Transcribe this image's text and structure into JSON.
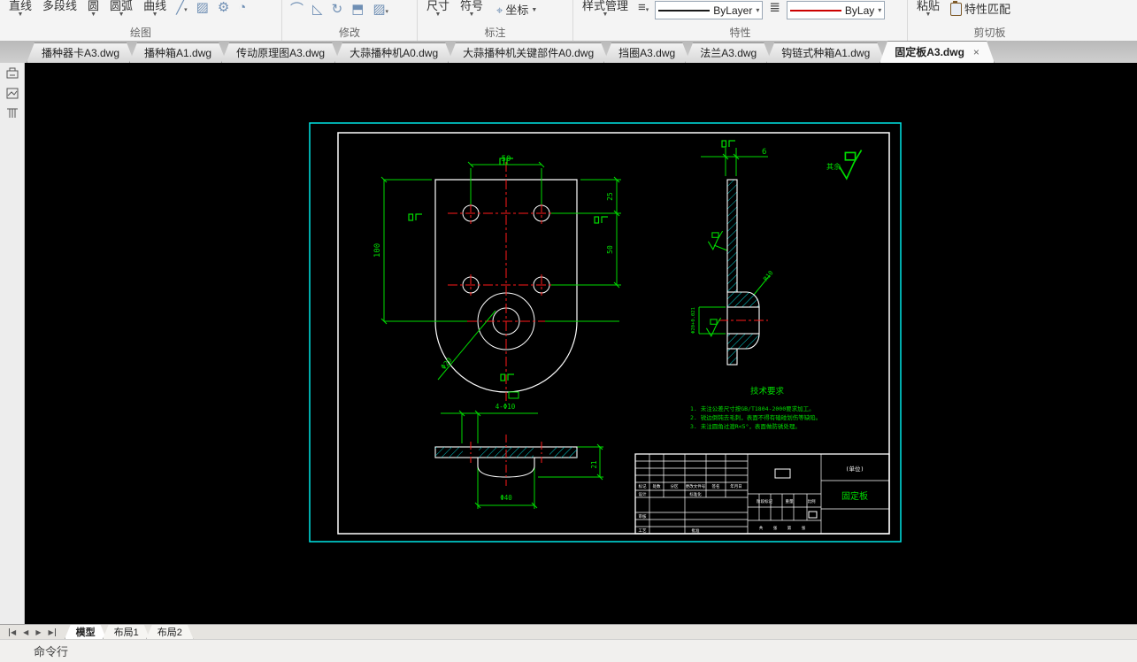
{
  "ribbon": {
    "draw": {
      "label": "绘图",
      "line": "直线",
      "polyline": "多段线",
      "circle": "圆",
      "arc": "圆弧",
      "spline": "曲线"
    },
    "modify": {
      "label": "修改"
    },
    "annotate": {
      "label": "标注",
      "dimension": "尺寸",
      "symbol": "符号",
      "coordinate": "坐标"
    },
    "properties": {
      "label": "特性",
      "style_manager": "样式管理",
      "linetype": "ByLayer",
      "color_ctrl": "ByLay"
    },
    "clipboard": {
      "label": "剪切板",
      "paste": "粘贴",
      "match_properties": "特性匹配"
    }
  },
  "file_tabs": {
    "tabs": [
      "播种器卡A3.dwg",
      "播种箱A1.dwg",
      "传动原理图A3.dwg",
      "大蒜播种机A0.dwg",
      "大蒜播种机关键部件A0.dwg",
      "挡圈A3.dwg",
      "法兰A3.dwg",
      "钩链式种箱A1.dwg",
      "固定板A3.dwg"
    ],
    "active": "固定板A3.dwg",
    "close_glyph": "×"
  },
  "drawing": {
    "dims": {
      "top_width": "50",
      "left_height": "100",
      "right_upper": "25",
      "right_lower": "50",
      "thickness": "6",
      "hole_pattern": "4-Φ10",
      "boss_diameter": "Φ40",
      "boss_height": "21",
      "center_hole": "Φ20",
      "fillet": "R10",
      "bore_tolerance": "Φ20+0.021",
      "surface_rest": "其余"
    },
    "tech_req": {
      "title": "技术要求",
      "items": [
        "1. 未注公差尺寸按GB/T1804-2000要求加工。",
        "2. 锐边倒钝去毛刺，表面不得有磕碰划伤等缺陷。",
        "3. 未注圆角过渡R<5°，表面做防锈处理。"
      ]
    },
    "title_block": {
      "unit": "(单位)",
      "part_name": "固定板",
      "header": [
        "标记",
        "处数",
        "分区",
        "更改文件号",
        "签名",
        "年月日"
      ],
      "row_design": "设计",
      "row_standard": "标准化",
      "row_check": "审核",
      "row_process": "工艺",
      "row_approve": "批准",
      "stage": "阶段标记",
      "weight": "重量",
      "scale": "比例",
      "sheet": [
        "共",
        "张",
        "第",
        "张"
      ]
    }
  },
  "model_bar": {
    "tabs": [
      "模型",
      "布局1",
      "布局2"
    ],
    "active": "模型",
    "nav": {
      "first": "◀",
      "prev": "◀",
      "next": "▶",
      "last": "▶"
    }
  },
  "command_line": {
    "label": "命令行"
  },
  "colors": {
    "cad_green": "#00dc00",
    "cad_red": "#ff1a1a",
    "cad_hatch_cyan": "#00cccc",
    "cad_white": "#ffffff",
    "viewport_border": "#00e5e5",
    "bylayer_line": "#1a1a1a",
    "bycolor_line": "#cc0000"
  }
}
